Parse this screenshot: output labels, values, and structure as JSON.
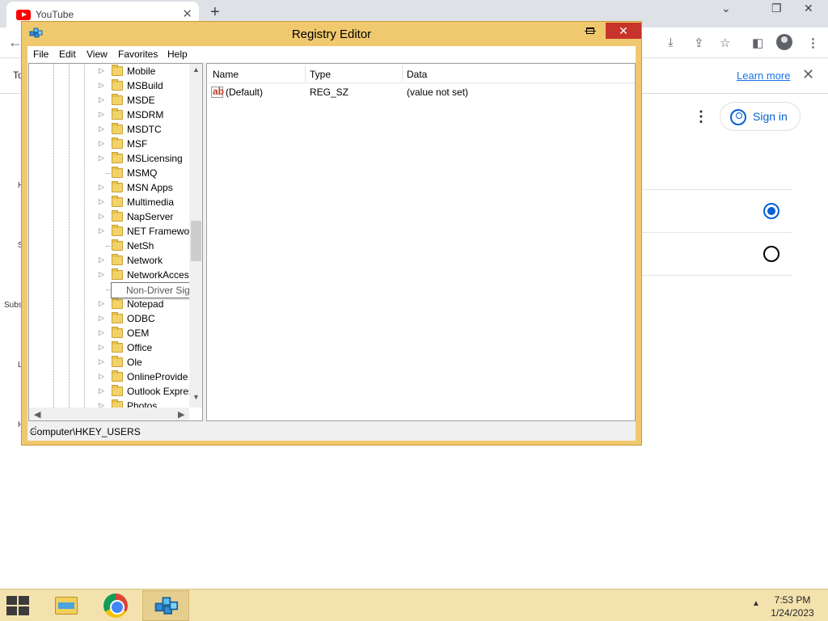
{
  "browser": {
    "tab_title": "YouTube",
    "tab_close": "✕",
    "new_tab": "+",
    "minimize_glyph": "⌄",
    "restore_glyph": "❐",
    "close_glyph": "✕",
    "back_glyph": "←",
    "infobar_text": "To",
    "learn_more": "Learn more",
    "infobar_close": "✕",
    "sign_in": "Sign in",
    "kebab": "⋮",
    "edge_letters": [
      "H",
      "S",
      "Subs",
      "L",
      "H"
    ]
  },
  "registry": {
    "title": "Registry Editor",
    "minimize": "—",
    "close": "✕",
    "menu": [
      "File",
      "Edit",
      "View",
      "Favorites",
      "Help"
    ],
    "tree_items": [
      {
        "label": "Mobile",
        "expandable": true
      },
      {
        "label": "MSBuild",
        "expandable": true
      },
      {
        "label": "MSDE",
        "expandable": true
      },
      {
        "label": "MSDRM",
        "expandable": true
      },
      {
        "label": "MSDTC",
        "expandable": true
      },
      {
        "label": "MSF",
        "expandable": true
      },
      {
        "label": "MSLicensing",
        "expandable": true
      },
      {
        "label": "MSMQ",
        "expandable": false
      },
      {
        "label": "MSN Apps",
        "expandable": true
      },
      {
        "label": "Multimedia",
        "expandable": true
      },
      {
        "label": "NapServer",
        "expandable": true
      },
      {
        "label": "NET Framewor",
        "expandable": true
      },
      {
        "label": "NetSh",
        "expandable": false
      },
      {
        "label": "Network",
        "expandable": true
      },
      {
        "label": "NetworkAcces",
        "expandable": true
      },
      {
        "label": "",
        "expandable": false
      },
      {
        "label": "Notepad",
        "expandable": true
      },
      {
        "label": "ODBC",
        "expandable": true
      },
      {
        "label": "OEM",
        "expandable": true
      },
      {
        "label": "Office",
        "expandable": true
      },
      {
        "label": "Ole",
        "expandable": true
      },
      {
        "label": "OnlineProvide",
        "expandable": true
      },
      {
        "label": "Outlook Expres",
        "expandable": true
      },
      {
        "label": "Photos",
        "expandable": true
      }
    ],
    "tooltip": "Non-Driver Signing",
    "columns": {
      "name": "Name",
      "type": "Type",
      "data": "Data"
    },
    "values": [
      {
        "name": "(Default)",
        "type": "REG_SZ",
        "data": "(value not set)",
        "icon": "ab-string-icon"
      }
    ],
    "status": "Computer\\HKEY_USERS",
    "scroll_up": "▲",
    "scroll_down": "▼",
    "scroll_left": "◀",
    "scroll_right": "▶"
  },
  "taskbar": {
    "time": "7:53 PM",
    "date": "1/24/2023",
    "tray_arrow": "▲"
  },
  "colors": {
    "window_frame": "#f0c86e",
    "close_button": "#c7342b",
    "taskbar": "#f4e2ae",
    "link": "#1a73e8",
    "youtube_blue": "#065fd4"
  }
}
